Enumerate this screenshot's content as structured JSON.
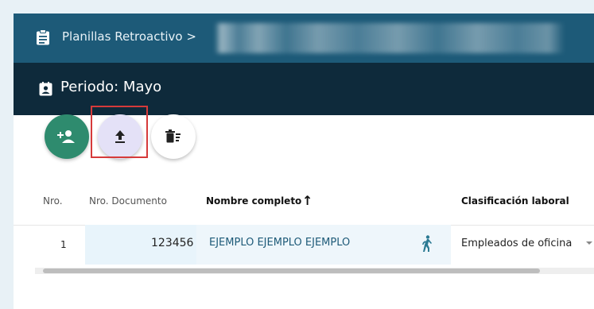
{
  "breadcrumb": {
    "title": "Planillas Retroactivo >"
  },
  "period": {
    "title": "Periodo: Mayo"
  },
  "actions": {
    "add_employee": "add-person-icon",
    "upload": "upload-icon",
    "delete": "delete-sweep-icon"
  },
  "table": {
    "columns": [
      "Nro.",
      "Nro. Documento",
      "Nombre completo",
      "Clasificación laboral"
    ],
    "sort_indicator": "↑",
    "rows": [
      {
        "nro": "1",
        "documento": "123456",
        "nombre": "EJEMPLO EJEMPLO EJEMPLO",
        "clasificacion": "Empleados de oficina"
      }
    ]
  },
  "colors": {
    "header_primary": "#1d5a78",
    "header_dark": "#0e2a3b",
    "fab_green": "#2e8b6e",
    "fab_upload": "#e4e1f7",
    "highlight": "#d63a3a",
    "link": "#1d5a78"
  }
}
